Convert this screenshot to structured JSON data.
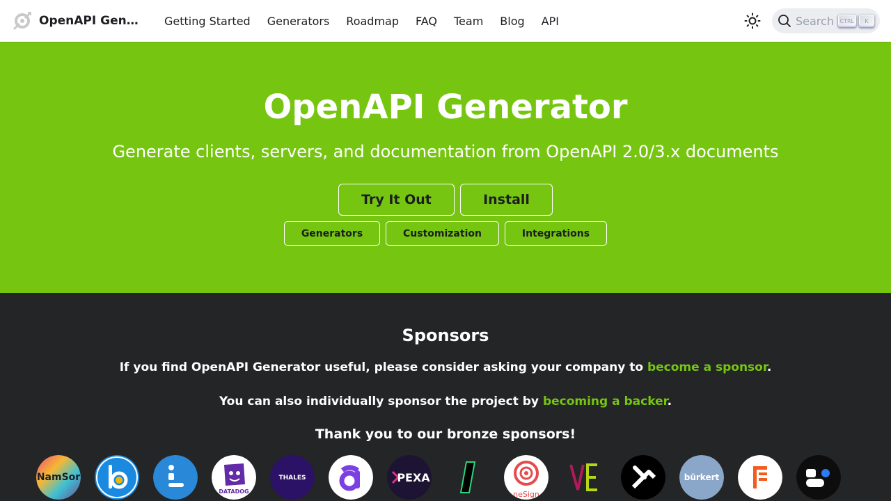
{
  "navbar": {
    "brand": "OpenAPI Generator",
    "links": [
      "Getting Started",
      "Generators",
      "Roadmap",
      "FAQ",
      "Team",
      "Blog",
      "API"
    ],
    "search": {
      "label": "Search",
      "key1": "CTRL",
      "key2": "K"
    }
  },
  "hero": {
    "title": "OpenAPI Generator",
    "subtitle": "Generate clients, servers, and documentation from OpenAPI 2.0/3.x documents",
    "primary_buttons": [
      "Try It Out",
      "Install"
    ],
    "secondary_buttons": [
      "Generators",
      "Customization",
      "Integrations"
    ]
  },
  "sponsors": {
    "title": "Sponsors",
    "line1_prefix": "If you find OpenAPI Generator useful, please consider asking your company to ",
    "line1_link": "become a sponsor",
    "line1_suffix": ".",
    "line2_prefix": "You can also individually sponsor the project by ",
    "line2_link": "becoming a backer",
    "line2_suffix": ".",
    "line3": "Thank you to our bronze sponsors!",
    "logos": {
      "namsor": "NamSor",
      "thales": "THALES",
      "datadog": "DATADOG",
      "pexa": "PEXA",
      "onesignal": "neSign",
      "burkert": "bürkert"
    }
  },
  "colors": {
    "accent": "#76c611",
    "dark_bg": "#242526",
    "navbar_bg": "#ffffff"
  }
}
